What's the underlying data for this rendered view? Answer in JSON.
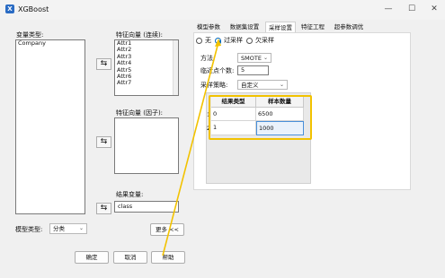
{
  "window": {
    "title": "XGBoost",
    "minimize": "—",
    "maximize": "☐",
    "close": "✕"
  },
  "left": {
    "var_type_label": "变量类型:",
    "var_type_items": [
      "Company"
    ],
    "feature_cont_label": "特征向量 (连续):",
    "feature_cont_items": [
      "Attr1",
      "Attr2",
      "Attr3",
      "Attr4",
      "Attr5",
      "Attr6",
      "Attr7"
    ],
    "feature_factor_label": "特征向量 (因子):",
    "result_label": "结果变量:",
    "result_value": "class",
    "model_type_label": "模型类型:",
    "model_type_value": "分类",
    "more_button": "更多 <<",
    "ok_button": "确定",
    "cancel_button": "取消",
    "help_button": "帮助",
    "swap_glyph": "⇆"
  },
  "tabs": [
    "模型参数",
    "数据集设置",
    "采样设置",
    "特征工程",
    "超参数调优"
  ],
  "active_tab": "采样设置",
  "sampling": {
    "radio_none": "无",
    "radio_over": "过采样",
    "radio_under": "欠采样",
    "method_label": "方法:",
    "method_value": "SMOTE",
    "neighbors_label": "临近点个数:",
    "neighbors_value": "5",
    "strategy_label": "采样策略:",
    "strategy_value": "自定义",
    "table": {
      "headers": [
        "结果类型",
        "样本数量"
      ],
      "row_headers": [
        "1",
        "2"
      ],
      "rows": [
        [
          "0",
          "6500"
        ],
        [
          "1",
          "1000"
        ]
      ]
    }
  },
  "colors": {
    "highlight": "#f2c200",
    "accent": "#0067c0"
  }
}
